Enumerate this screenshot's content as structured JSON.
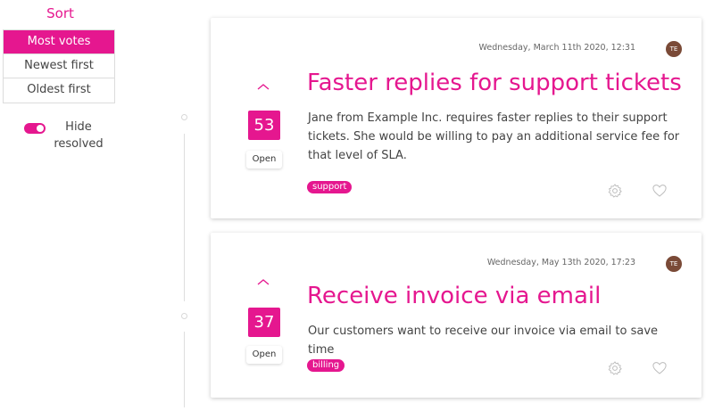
{
  "sidebar": {
    "sort_title": "Sort",
    "sort_options": [
      {
        "label": "Most votes",
        "active": true
      },
      {
        "label": "Newest first",
        "active": false
      },
      {
        "label": "Oldest first",
        "active": false
      }
    ],
    "hide_resolved_label": "Hide resolved",
    "hide_resolved_on": true
  },
  "accent_color": "#e5178f",
  "cards": [
    {
      "date": "Wednesday, March 11th 2020, 12:31",
      "avatar": "TE",
      "votes": "53",
      "status": "Open",
      "title": "Faster replies for support tickets",
      "description": "Jane from Example Inc. requires faster replies to their support tickets. She would be willing to pay an additional service fee for that level of SLA.",
      "tag": "support"
    },
    {
      "date": "Wednesday, May 13th 2020, 17:23",
      "avatar": "TE",
      "votes": "37",
      "status": "Open",
      "title": "Receive invoice via email",
      "description": "Our customers want to receive our invoice via email to save time",
      "tag": "billing"
    }
  ],
  "icons": {
    "upvote": "chevron-up-icon",
    "settings": "gear-icon",
    "favorite": "heart-icon"
  }
}
